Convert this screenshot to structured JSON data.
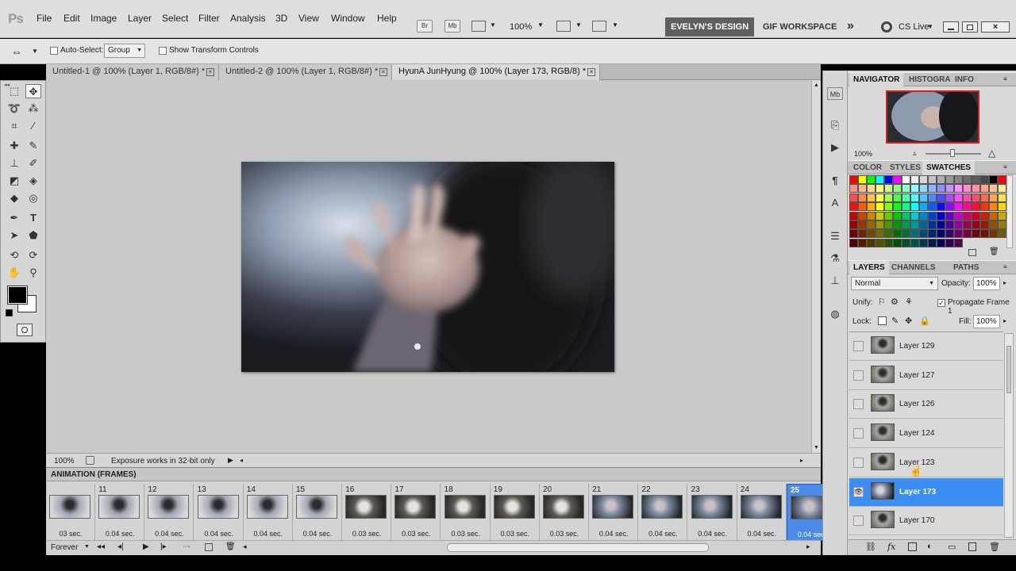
{
  "app": {
    "logo": "Ps"
  },
  "menu": [
    "File",
    "Edit",
    "Image",
    "Layer",
    "Select",
    "Filter",
    "Analysis",
    "3D",
    "View",
    "Window",
    "Help"
  ],
  "menubar": {
    "bridge_label": "Br",
    "minibridge_label": "Mb",
    "zoom": "100%",
    "workspace1": "EVELYN'S DESIGN",
    "workspace2": "GIF WORKSPACE",
    "more": "»",
    "cslive": "CS Live"
  },
  "options": {
    "autoselect_label": "Auto-Select:",
    "autoselect_value": "Group",
    "transform_label": "Show Transform Controls"
  },
  "tabs": [
    {
      "label": "Untitled-1 @ 100% (Layer 1, RGB/8#) *"
    },
    {
      "label": "Untitled-2 @ 100% (Layer 1, RGB/8#) *"
    },
    {
      "label": "HyunA JunHyung @ 100% (Layer 173, RGB/8) *"
    }
  ],
  "status": {
    "zoom": "100%",
    "message": "Exposure works in 32-bit only"
  },
  "animation": {
    "title": "ANIMATION (FRAMES)",
    "loop": "Forever",
    "frames": [
      {
        "num": "",
        "delay": "03 sec."
      },
      {
        "num": "11",
        "delay": "0.04 sec."
      },
      {
        "num": "12",
        "delay": "0.04 sec."
      },
      {
        "num": "13",
        "delay": "0.04 sec."
      },
      {
        "num": "14",
        "delay": "0.04 sec."
      },
      {
        "num": "15",
        "delay": "0.04 sec."
      },
      {
        "num": "16",
        "delay": "0.03 sec."
      },
      {
        "num": "17",
        "delay": "0.03 sec."
      },
      {
        "num": "18",
        "delay": "0.03 sec."
      },
      {
        "num": "19",
        "delay": "0.03 sec."
      },
      {
        "num": "20",
        "delay": "0.03 sec."
      },
      {
        "num": "21",
        "delay": "0.04 sec."
      },
      {
        "num": "22",
        "delay": "0.04 sec."
      },
      {
        "num": "23",
        "delay": "0.04 sec."
      },
      {
        "num": "24",
        "delay": "0.04 sec."
      },
      {
        "num": "25",
        "delay": "0.04 sec."
      }
    ]
  },
  "navigator": {
    "tabs": [
      "NAVIGATOR",
      "HISTOGRA",
      "INFO"
    ],
    "zoom": "100%"
  },
  "swatches": {
    "tabs": [
      "COLOR",
      "STYLES",
      "SWATCHES"
    ]
  },
  "layers": {
    "tabs": [
      "LAYERS",
      "CHANNELS",
      "PATHS"
    ],
    "blend_mode": "Normal",
    "opacity_label": "Opacity:",
    "opacity": "100%",
    "unify_label": "Unify:",
    "propagate_label": "Propagate Frame 1",
    "lock_label": "Lock:",
    "fill_label": "Fill:",
    "fill": "100%",
    "rows": [
      {
        "name": "Layer 129",
        "visible": false,
        "selected": false
      },
      {
        "name": "Layer 127",
        "visible": false,
        "selected": false
      },
      {
        "name": "Layer 126",
        "visible": false,
        "selected": false
      },
      {
        "name": "Layer 124",
        "visible": false,
        "selected": false
      },
      {
        "name": "Layer 123",
        "visible": false,
        "selected": false
      },
      {
        "name": "Layer 173",
        "visible": true,
        "selected": true
      },
      {
        "name": "Layer 170",
        "visible": false,
        "selected": false
      }
    ]
  },
  "colors": {
    "accent": "#3d8ef2",
    "foreground": "#000000",
    "background": "#ffffff"
  }
}
